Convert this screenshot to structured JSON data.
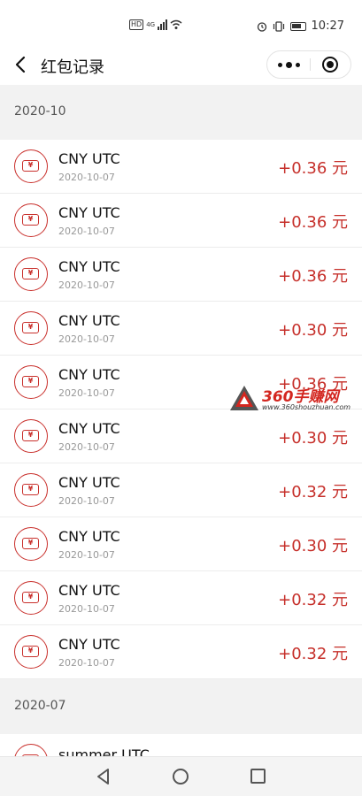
{
  "status_bar": {
    "network": "4G",
    "time": "10:27"
  },
  "nav": {
    "title": "红包记录"
  },
  "sections": [
    {
      "month": "2020-10",
      "rows": [
        {
          "title": "CNY UTC",
          "date": "2020-10-07",
          "amount": "+0.36 元"
        },
        {
          "title": "CNY UTC",
          "date": "2020-10-07",
          "amount": "+0.36 元"
        },
        {
          "title": "CNY UTC",
          "date": "2020-10-07",
          "amount": "+0.36 元"
        },
        {
          "title": "CNY UTC",
          "date": "2020-10-07",
          "amount": "+0.30 元"
        },
        {
          "title": "CNY UTC",
          "date": "2020-10-07",
          "amount": "+0.36 元"
        },
        {
          "title": "CNY UTC",
          "date": "2020-10-07",
          "amount": "+0.30 元"
        },
        {
          "title": "CNY UTC",
          "date": "2020-10-07",
          "amount": "+0.32 元"
        },
        {
          "title": "CNY UTC",
          "date": "2020-10-07",
          "amount": "+0.30 元"
        },
        {
          "title": "CNY UTC",
          "date": "2020-10-07",
          "amount": "+0.32 元"
        },
        {
          "title": "CNY UTC",
          "date": "2020-10-07",
          "amount": "+0.32 元"
        }
      ]
    },
    {
      "month": "2020-07",
      "rows": [
        {
          "title": "summer UTC"
        }
      ]
    }
  ],
  "icons": {
    "row_icon": "red-packet-ticket-icon",
    "ticket_glyph": "¥"
  },
  "watermark": {
    "title": "360手赚网",
    "url": "www.360shouzhuan.com"
  },
  "colors": {
    "amount": "#c62f2a",
    "icon": "#c9302c"
  }
}
